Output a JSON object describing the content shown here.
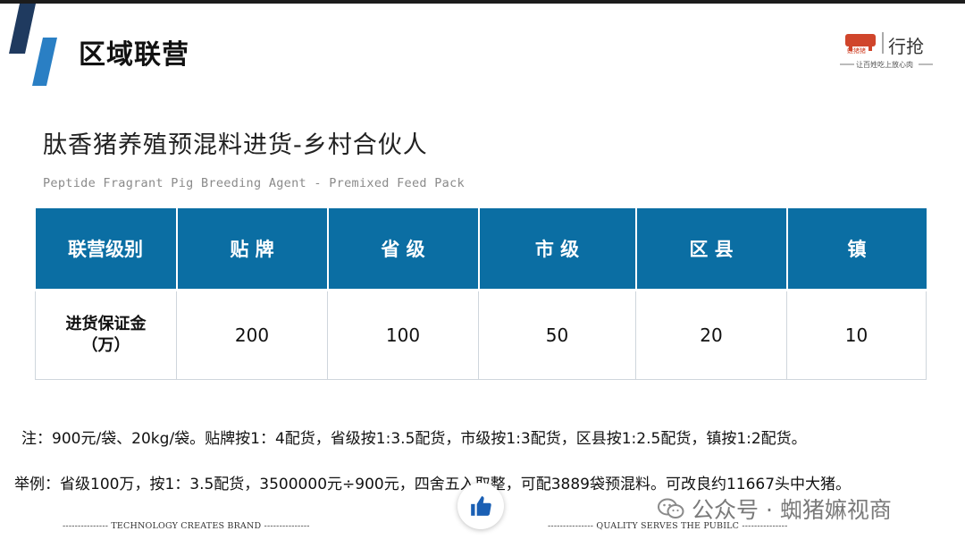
{
  "header": {
    "section_title": "区域联营",
    "brand": {
      "logo_sub": "蛙猪猪",
      "logo_main": "行抢",
      "slogan": "让百姓吃上放心肉"
    }
  },
  "content": {
    "title": "肽香猪养殖预混料进货-乡村合伙人",
    "subtitle": "Peptide Fragrant Pig Breeding Agent - Premixed Feed Pack"
  },
  "table": {
    "headers": [
      "联营级别",
      "贴 牌",
      "省 级",
      "市 级",
      "区 县",
      "镇"
    ],
    "row": {
      "label_line1": "进货保证金",
      "label_line2": "（万）",
      "values": [
        "200",
        "100",
        "50",
        "20",
        "10"
      ]
    }
  },
  "note": "注：900元/袋、20kg/袋。贴牌按1：4配货，省级按1:3.5配货，市级按1:3配货，区县按1:2.5配货，镇按1:2配货。",
  "example": "举例：省级100万，按1：3.5配货，3500000元÷900元，四舍五入取整，可配3889袋预混料。可改良约11667头中大猪。",
  "footer": {
    "left": "---------------    TECHNOLOGY CREATES BRAND    ---------------",
    "right": "---------------    QUALITY SERVES THE PUBILC    ---------------"
  },
  "watermark": "公众号 · 蜘猪嫲视商",
  "colors": {
    "accent": "#0b6ea3",
    "deco_dark": "#1f3a5f",
    "deco_light": "#2a7fc4"
  },
  "icons": {
    "like": "thumbs-up-icon",
    "wechat": "wechat-icon"
  }
}
